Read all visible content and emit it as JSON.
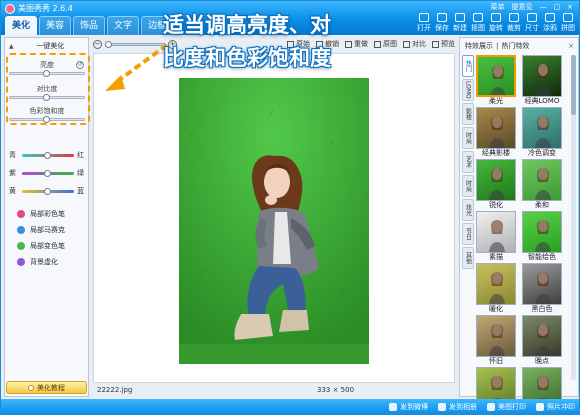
{
  "app": {
    "title": "美图秀秀 2.6.4"
  },
  "window_controls": [
    "菜单",
    "提意见",
    "—",
    "□",
    "×"
  ],
  "tabs": [
    {
      "label": "美化",
      "active": true
    },
    {
      "label": "美容",
      "active": false
    },
    {
      "label": "饰品",
      "active": false
    },
    {
      "label": "文字",
      "active": false
    },
    {
      "label": "边框",
      "active": false
    }
  ],
  "toolbar": [
    "打开",
    "保存",
    "新建",
    "抠图",
    "旋转",
    "裁剪",
    "尺寸",
    "涂鸦",
    "拼图"
  ],
  "left_panel": {
    "one_click_label": "一键美化",
    "sliders": [
      {
        "label": "亮度",
        "value": 50
      },
      {
        "label": "对比度",
        "value": 50
      },
      {
        "label": "色彩饱和度",
        "value": 50
      }
    ],
    "color_sliders": [
      {
        "left": "青",
        "right": "红",
        "value": 50,
        "colors": [
          "#35c9c9",
          "#e03a3a"
        ]
      },
      {
        "left": "紫",
        "right": "绿",
        "value": 50,
        "colors": [
          "#b04ad0",
          "#36b84a"
        ]
      },
      {
        "left": "黄",
        "right": "蓝",
        "value": 50,
        "colors": [
          "#e8c22a",
          "#3a6fe0"
        ]
      }
    ],
    "tools": [
      {
        "label": "局部彩色笔",
        "icon": "color-brush-icon",
        "color": "#e04a8a"
      },
      {
        "label": "局部马赛克",
        "icon": "mosaic-icon",
        "color": "#3a8fe0"
      },
      {
        "label": "局部变色笔",
        "icon": "recolor-brush-icon",
        "color": "#4ab850"
      },
      {
        "label": "背景虚化",
        "icon": "blur-background-icon",
        "color": "#8a5cd0"
      }
    ],
    "tutorial_label": "美化教程"
  },
  "canvas_toolbar": {
    "zoom_minus": "−",
    "zoom_plus": "+",
    "zoom_level": 0,
    "buttons": [
      {
        "label": "原始",
        "icon": "original-size-icon"
      },
      {
        "label": "撤销",
        "icon": "undo-icon"
      },
      {
        "label": "重做",
        "icon": "redo-icon"
      },
      {
        "label": "原图",
        "icon": "original-image-icon"
      },
      {
        "label": "对比",
        "icon": "compare-icon"
      },
      {
        "label": "预览",
        "icon": "preview-icon"
      }
    ]
  },
  "canvas": {
    "filename": "22222.jpg",
    "image_size": "333 × 500"
  },
  "right_panel": {
    "tabs": [
      "特效展示",
      "热门特效"
    ],
    "close_label": "×",
    "categories": [
      "热门",
      "LOMO",
      "影楼",
      "时尚",
      "艺术",
      "时尚",
      "炫光",
      "节日",
      "其他"
    ],
    "effects": [
      {
        "label": "柔光",
        "selected": true,
        "tone": [
          "#48c040",
          "#2b8f24"
        ]
      },
      {
        "label": "经典LOMO",
        "selected": false,
        "tone": [
          "#3a7f2c",
          "#0f2a0c"
        ]
      },
      {
        "label": "经典影楼",
        "selected": false,
        "tone": [
          "#a78a4a",
          "#5a4a26"
        ]
      },
      {
        "label": "冷色调变",
        "selected": false,
        "tone": [
          "#5ab0a0",
          "#2f6f6a"
        ]
      },
      {
        "label": "锐化",
        "selected": false,
        "tone": [
          "#46b83c",
          "#1f7a18"
        ]
      },
      {
        "label": "柔和",
        "selected": false,
        "tone": [
          "#6ec860",
          "#3e9a34"
        ]
      },
      {
        "label": "素描",
        "selected": false,
        "tone": [
          "#f0f0f0",
          "#b0b0b0"
        ]
      },
      {
        "label": "智能绘色",
        "selected": false,
        "tone": [
          "#58d04a",
          "#2aa020"
        ]
      },
      {
        "label": "暖化",
        "selected": false,
        "tone": [
          "#c8c060",
          "#8a8a30"
        ]
      },
      {
        "label": "黑白色",
        "selected": false,
        "tone": [
          "#9a9a9a",
          "#404040"
        ]
      },
      {
        "label": "怀旧",
        "selected": false,
        "tone": [
          "#c0a878",
          "#6e5a3a"
        ]
      },
      {
        "label": "晚点",
        "selected": false,
        "tone": [
          "#7a8a6a",
          "#3a3a2a"
        ]
      },
      {
        "label": "",
        "selected": false,
        "tone": [
          "#a8c050",
          "#5a7a28"
        ]
      },
      {
        "label": "",
        "selected": false,
        "tone": [
          "#7ab060",
          "#3a6a28"
        ]
      }
    ]
  },
  "status_bar": [
    {
      "label": "发到微博",
      "icon": "weibo-icon"
    },
    {
      "label": "发到相册",
      "icon": "album-icon"
    },
    {
      "label": "美图打印",
      "icon": "print-icon"
    },
    {
      "label": "照片冲印",
      "icon": "photo-print-icon"
    }
  ],
  "annotation": {
    "line1": "适当调高亮度、对",
    "line2": "比度和色彩饱和度",
    "color": "#f59e00"
  }
}
